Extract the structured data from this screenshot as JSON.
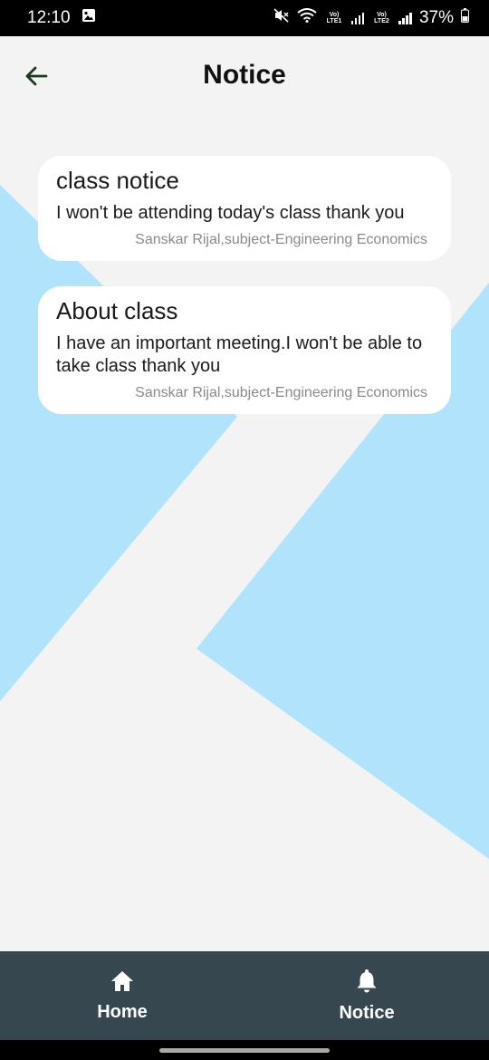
{
  "status_bar": {
    "time": "12:10",
    "sim1_label": "Vo) LTE1",
    "sim2_label": "Vo) LTE2",
    "battery": "37%"
  },
  "header": {
    "title": "Notice"
  },
  "notices": [
    {
      "title": "class notice",
      "body": "I won't be attending today's class thank you",
      "author": "Sanskar Rijal,subject-Engineering Economics"
    },
    {
      "title": "About class",
      "body": "I have an important meeting.I won't be able to take class thank you",
      "author": "Sanskar Rijal,subject-Engineering Economics"
    }
  ],
  "bottom_nav": {
    "items": [
      {
        "label": "Home",
        "icon": "home-icon"
      },
      {
        "label": "Notice",
        "icon": "bell-icon"
      }
    ]
  },
  "colors": {
    "background": "#f3f3f3",
    "decor_blue": "#b1e3fc",
    "nav_bar": "#37474f",
    "card": "#ffffff",
    "back_arrow": "#1b3a1b"
  }
}
